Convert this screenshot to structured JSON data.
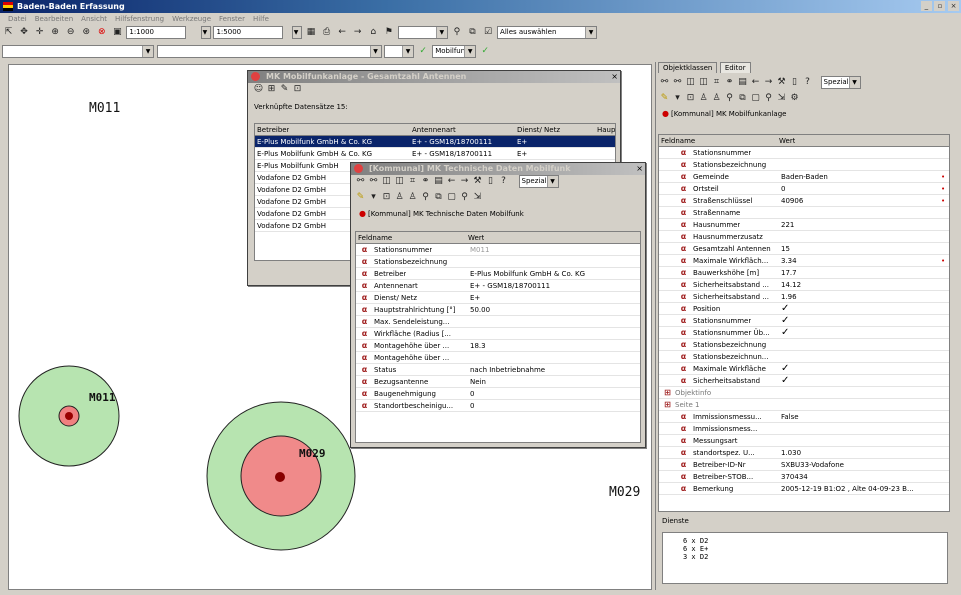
{
  "app": {
    "title": "Baden-Baden Erfassung"
  },
  "menu": [
    "Datei",
    "Bearbeiten",
    "Ansicht",
    "Hilfsfenstrung",
    "Werkzeuge",
    "Fenster",
    "Hilfe"
  ],
  "toolbar": {
    "scale1": "1:1000",
    "scale2": "1:5000",
    "layer": "Mobilfunk",
    "select": "Alles auswählen"
  },
  "map": {
    "labels": {
      "m011_top": "M011",
      "m011_circle": "M011",
      "m029_circle": "M029",
      "m029_right": "M029"
    }
  },
  "win1": {
    "title": "MK Mobilfunkanlage - Gesamtzahl Antennen",
    "count": "Verknüpfte Datensätze 15:",
    "headers": [
      "Betreiber",
      "Antennenart",
      "Dienst/ Netz",
      "Haupts"
    ],
    "rows": [
      [
        "E-Plus Mobilfunk GmbH & Co. KG",
        "E+ - GSM18/18700111",
        "E+"
      ],
      [
        "E-Plus Mobilfunk GmbH & Co. KG",
        "E+ - GSM18/18700111",
        "E+"
      ],
      [
        "E-Plus Mobilfunk GmbH",
        "",
        ""
      ],
      [
        "Vodafone D2 GmbH",
        "",
        ""
      ],
      [
        "Vodafone D2 GmbH",
        "",
        ""
      ],
      [
        "Vodafone D2 GmbH",
        "",
        ""
      ],
      [
        "Vodafone D2 GmbH",
        "",
        ""
      ],
      [
        "Vodafone D2 GmbH",
        "",
        ""
      ]
    ]
  },
  "win2": {
    "title": "[Kommunal] MK Technische Daten Mobilfunk",
    "special": "Spezial",
    "caption": "[Kommunal] MK Technische Daten Mobilfunk",
    "headers": [
      "Feldname",
      "Wert"
    ],
    "rows": [
      [
        "Stationsnummer",
        "M011"
      ],
      [
        "Stationsbezeichnung",
        ""
      ],
      [
        "Betreiber",
        "E-Plus Mobilfunk GmbH & Co. KG"
      ],
      [
        "Antennenart",
        "E+ - GSM18/18700111"
      ],
      [
        "Dienst/ Netz",
        "E+"
      ],
      [
        "Hauptstrahlrichtung [°]",
        "50.00"
      ],
      [
        "Max. Sendeleistung...",
        ""
      ],
      [
        "Wirkfläche (Radius [...",
        ""
      ],
      [
        "Montagehöhe über ...",
        "18.3"
      ],
      [
        "Montagehöhe über ...",
        ""
      ],
      [
        "Status",
        "nach Inbetriebnahme"
      ],
      [
        "Bezugsantenne",
        "Nein"
      ],
      [
        "Baugenehmigung",
        "0"
      ],
      [
        "Standortbescheinigu...",
        "0"
      ]
    ]
  },
  "panel": {
    "tabs": [
      "Objektklassen",
      "Editor"
    ],
    "special": "Spezial",
    "caption": "[Kommunal] MK Mobilfunkanlage",
    "headers": [
      "Feldname",
      "Wert"
    ],
    "rows": [
      [
        "Stationsnummer",
        "",
        false
      ],
      [
        "Stationsbezeichnung",
        "",
        false
      ],
      [
        "Gemeinde",
        "Baden-Baden",
        true
      ],
      [
        "Ortsteil",
        "0",
        true
      ],
      [
        "Straßenschlüssel",
        "40906",
        true
      ],
      [
        "Straßenname",
        "",
        false
      ],
      [
        "Hausnummer",
        "221",
        false
      ],
      [
        "Hausnummerzusatz",
        "",
        false
      ],
      [
        "Gesamtzahl Antennen",
        "15",
        false
      ],
      [
        "Maximale Wirkfläch...",
        "3.34",
        true
      ],
      [
        "Bauwerkshöhe [m]",
        "17.7",
        false
      ],
      [
        "Sicherheitsabstand ...",
        "14.12",
        false
      ],
      [
        "Sicherheitsabstand ...",
        "1.96",
        false
      ],
      [
        "Position",
        "✓",
        false
      ],
      [
        "Stationsnummer",
        "✓",
        false
      ],
      [
        "Stationsnummer Üb...",
        "✓",
        false
      ],
      [
        "Stationsbezeichnung",
        "",
        false
      ],
      [
        "Stationsbezeichnun...",
        "",
        false
      ],
      [
        "Maximale Wirkfläche",
        "✓",
        false
      ],
      [
        "Sicherheitsabstand",
        "✓",
        false
      ],
      [
        "Objektinfo",
        "",
        false
      ],
      [
        "Seite 1",
        "",
        false
      ],
      [
        "Immissionsmessu...",
        "False",
        false
      ],
      [
        "Immissionsmess...",
        "",
        false
      ],
      [
        "Messungsart",
        "",
        false
      ],
      [
        "standortspez. U...",
        "1.030",
        false
      ],
      [
        "Betreiber-ID-Nr",
        "SXBU33-Vodafone",
        false
      ],
      [
        "Betreiber-STOB...",
        "370434",
        false
      ],
      [
        "Bemerkung",
        "2005-12-19 B1:O2 , Alte 04-09-23 B...",
        false
      ]
    ],
    "dienste_label": "Dienste",
    "dienste": [
      "6 x D2",
      "6 x E+",
      "3 x D2"
    ]
  }
}
